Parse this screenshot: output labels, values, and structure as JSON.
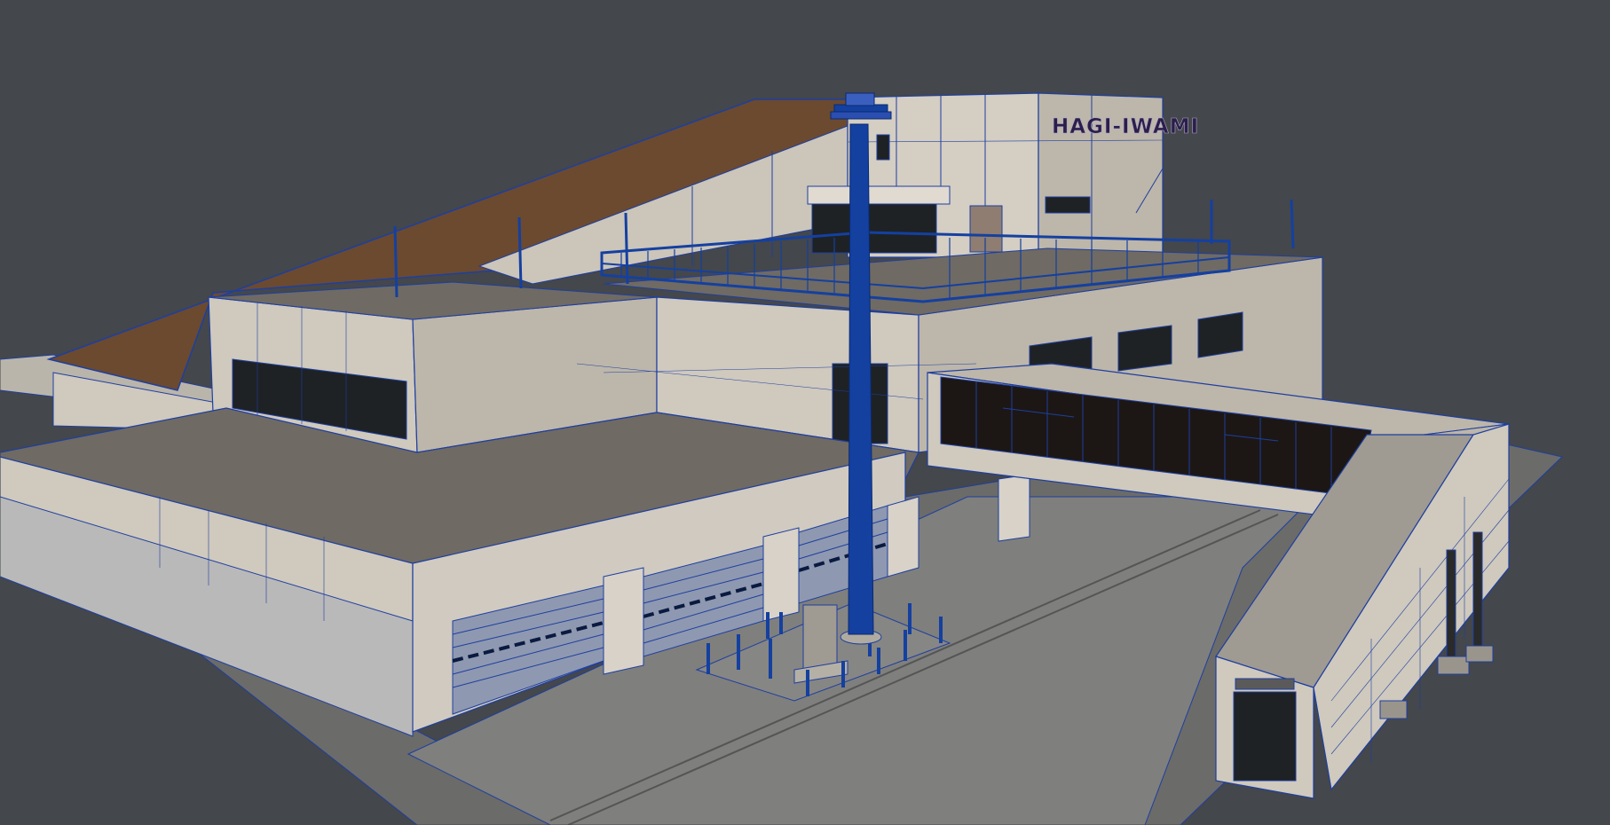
{
  "viewport": {
    "background_color": "#44474b",
    "wireframe_color": "#1e3fa0",
    "building_sign": "HAGI-IWAMI"
  },
  "colors": {
    "wall_light": "#cfc9be",
    "wall_mid": "#bdb6aa",
    "wall_shade": "#9f9a92",
    "roof_gravel": "#6f6a63",
    "roof_brown": "#6b4a30",
    "ground": "#7d7d7b",
    "ground_dark": "#6b6b69",
    "glass": "#1e2225",
    "glass_brown": "#1c1715",
    "steel_blue": "#1440a0"
  }
}
